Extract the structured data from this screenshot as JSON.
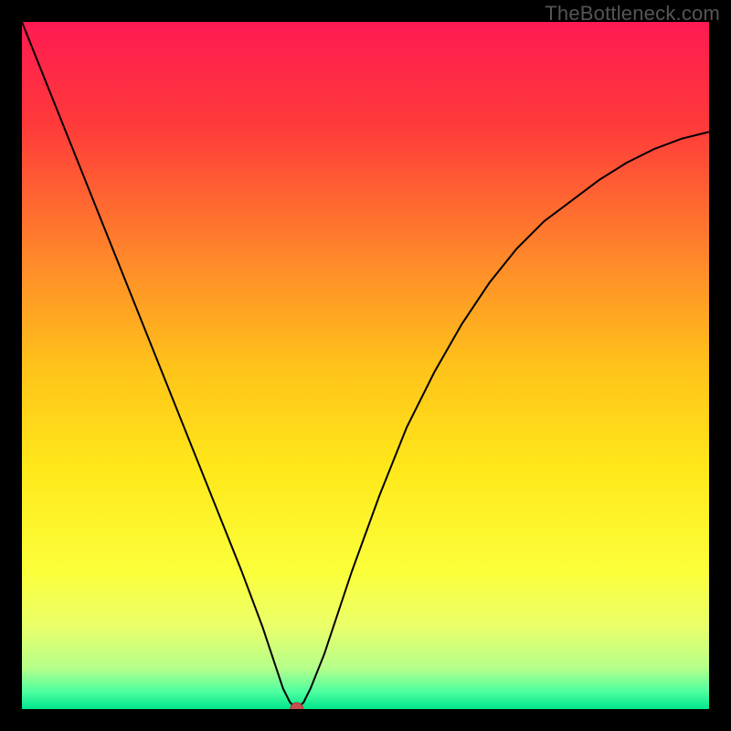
{
  "watermark": "TheBottleneck.com",
  "chart_data": {
    "type": "line",
    "title": "",
    "xlabel": "",
    "ylabel": "",
    "xlim": [
      0,
      100
    ],
    "ylim": [
      0,
      100
    ],
    "background_gradient": {
      "direction": "vertical",
      "stops": [
        {
          "pos": 0.0,
          "color": "#ff1a53"
        },
        {
          "pos": 0.15,
          "color": "#ff3a3a"
        },
        {
          "pos": 0.35,
          "color": "#ff8a2a"
        },
        {
          "pos": 0.5,
          "color": "#ffc21a"
        },
        {
          "pos": 0.65,
          "color": "#ffe81a"
        },
        {
          "pos": 0.8,
          "color": "#fbff3a"
        },
        {
          "pos": 0.88,
          "color": "#eaff6a"
        },
        {
          "pos": 0.94,
          "color": "#b6ff8a"
        },
        {
          "pos": 0.975,
          "color": "#4dffa0"
        },
        {
          "pos": 1.0,
          "color": "#00e58c"
        }
      ]
    },
    "series": [
      {
        "name": "bottleneck-curve",
        "color": "#000000",
        "width": 2,
        "x": [
          0,
          4,
          8,
          12,
          16,
          20,
          24,
          28,
          32,
          35,
          37,
          38,
          39,
          40,
          41,
          42,
          44,
          48,
          52,
          56,
          60,
          64,
          68,
          72,
          76,
          80,
          84,
          88,
          92,
          96,
          100
        ],
        "values": [
          100,
          90,
          80,
          70,
          60,
          50,
          40,
          30,
          20,
          12,
          6,
          3,
          1,
          0,
          1,
          3,
          8,
          20,
          31,
          41,
          49,
          56,
          62,
          67,
          71,
          74,
          77,
          79.5,
          81.5,
          83,
          84
        ]
      }
    ],
    "marker": {
      "name": "optimal-point",
      "x": 40,
      "y": 0,
      "radius": 7,
      "fill": "#c94f4f",
      "stroke": "#a23c3c"
    }
  }
}
